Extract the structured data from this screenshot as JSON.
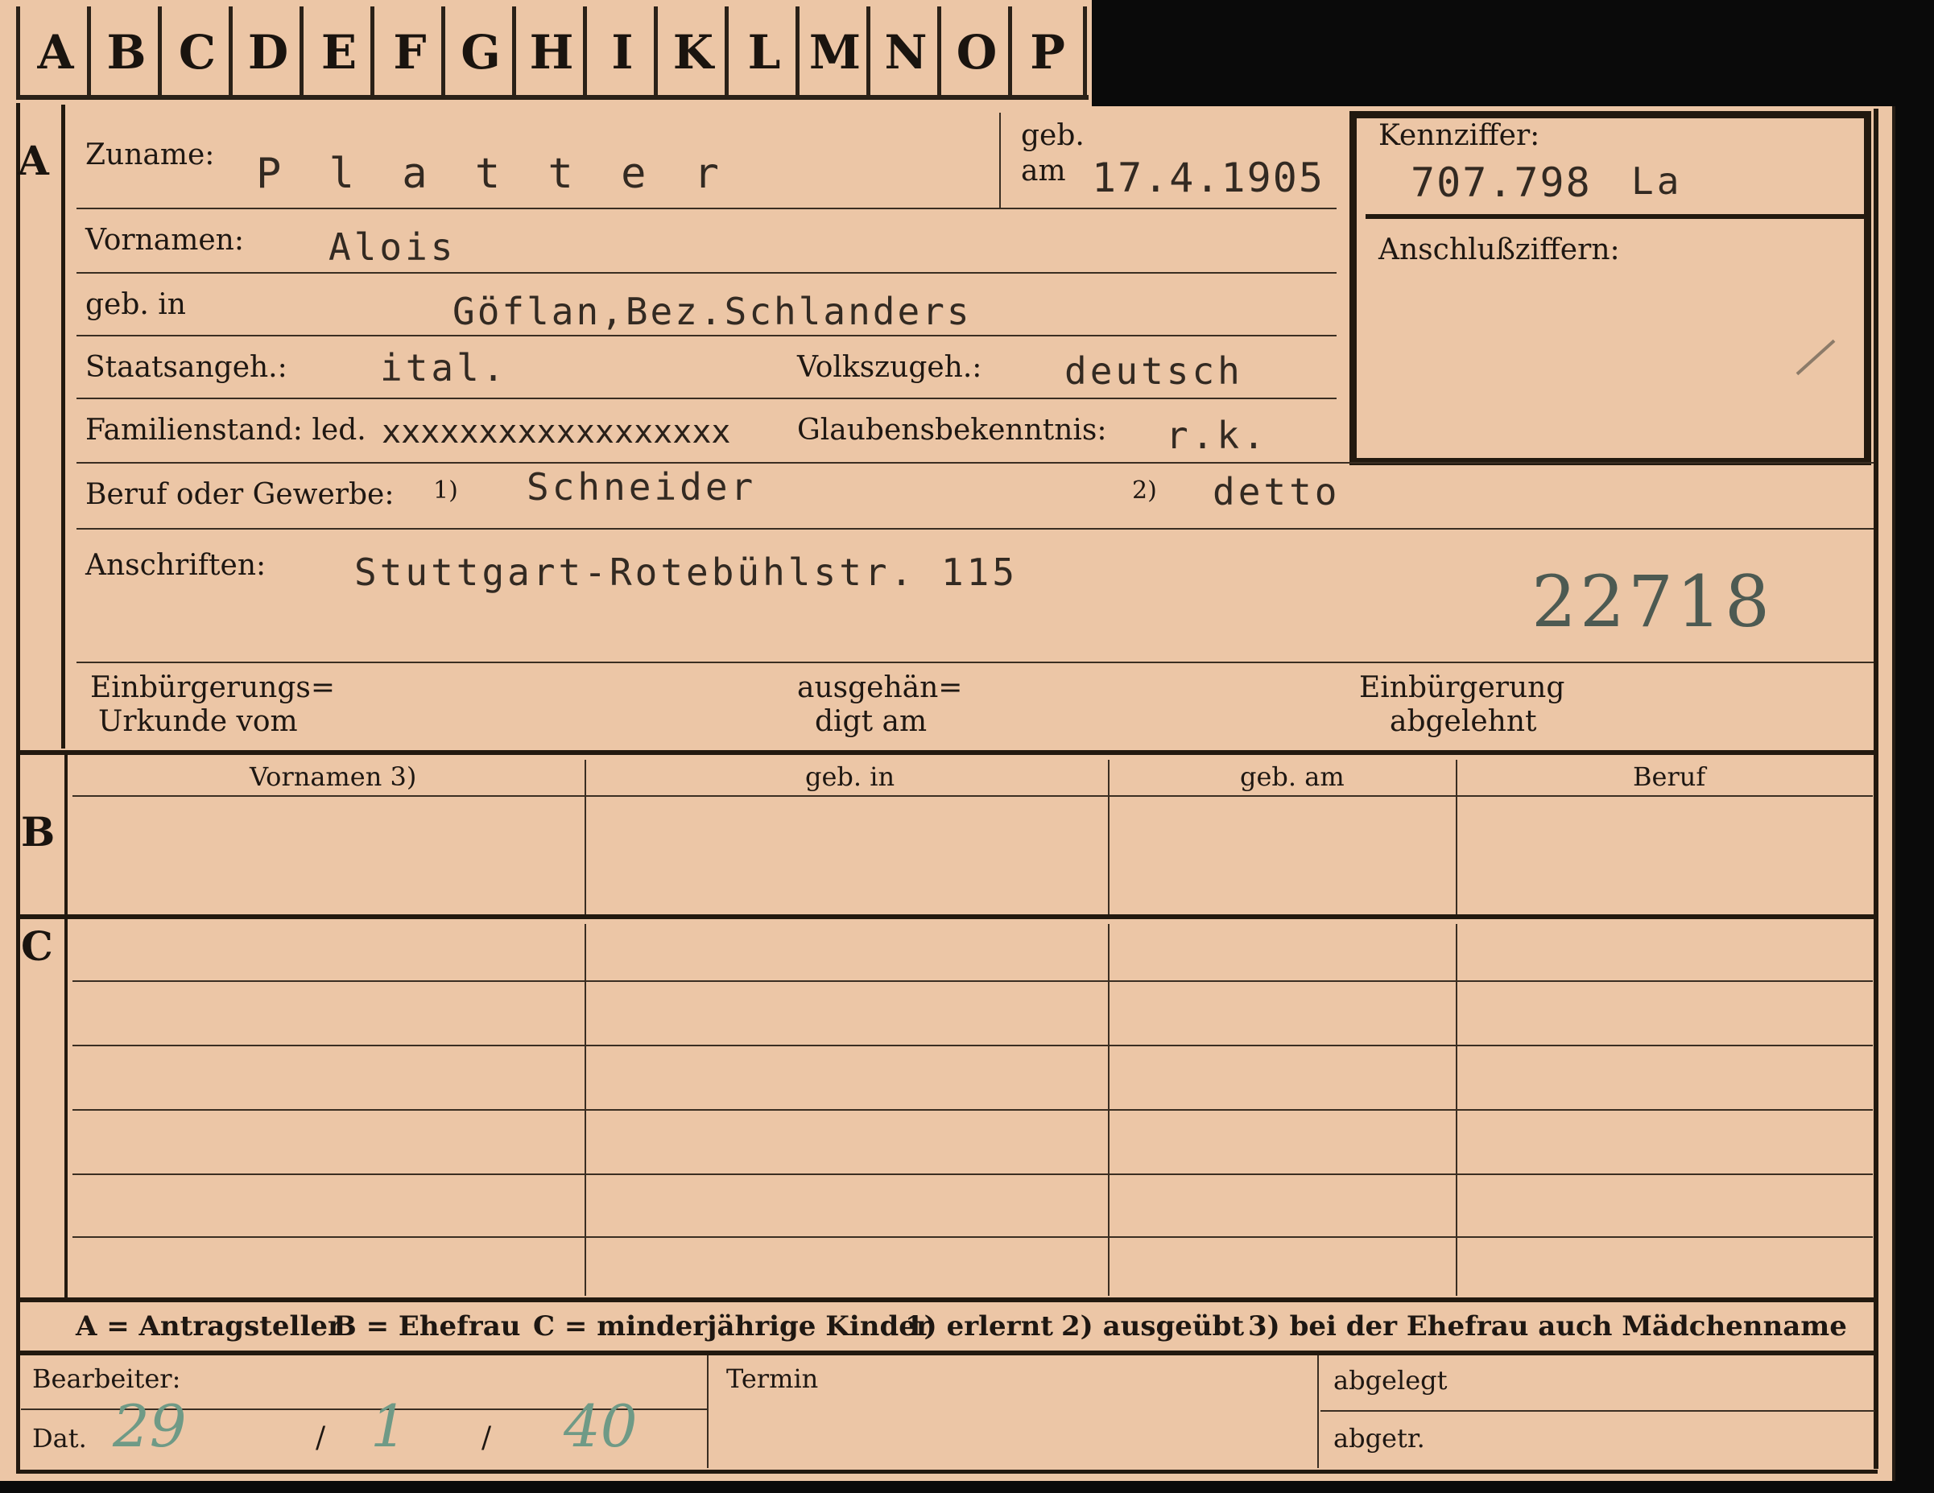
{
  "tabs": [
    "A",
    "B",
    "C",
    "D",
    "E",
    "F",
    "G",
    "H",
    "I",
    "K",
    "L",
    "M",
    "N",
    "O",
    "P"
  ],
  "section_markers": {
    "a": "A",
    "b": "B",
    "c": "C"
  },
  "fields": {
    "zuname_label": "Zuname:",
    "zuname_value": "P l a t t e r",
    "geb_label": "geb.",
    "am_label": "am",
    "geb_am_value": "17.4.1905",
    "kennziffer_label": "Kennziffer:",
    "kennziffer_value": "707.798",
    "kennziffer_suffix": "La",
    "anschluss_label": "Anschlußziffern:",
    "vornamen_label": "Vornamen:",
    "vornamen_value": "Alois",
    "geb_in_label": "geb. in",
    "geb_in_value": "Göflan,Bez.Schlanders",
    "staatsangeh_label": "Staatsangeh.:",
    "staatsangeh_value": "ital.",
    "volkszugeh_label": "Volkszugeh.:",
    "volkszugeh_value": "deutsch",
    "familienstand_label": "Familienstand: led.",
    "familienstand_struck": "xxxxxxxxxxxxxxxxxx",
    "glauben_label": "Glaubensbekenntnis:",
    "glauben_value": "r.k.",
    "beruf_label": "Beruf oder Gewerbe:",
    "beruf_note1": "1)",
    "beruf_value1": "Schneider",
    "beruf_note2": "2)",
    "beruf_value2": "detto",
    "anschriften_label": "Anschriften:",
    "anschriften_value": "Stuttgart-Rotebühlstr. 115",
    "stamp_number": "22718",
    "einb_urkunde_1": "Einbürgerungs=",
    "einb_urkunde_2": "Urkunde vom",
    "ausgehaen_1": "ausgehän=",
    "ausgehaen_2": "digt am",
    "einb_abgelehnt_1": "Einbürgerung",
    "einb_abgelehnt_2": "abgelehnt"
  },
  "table_b_headers": [
    "Vornamen 3)",
    "geb. in",
    "geb. am",
    "Beruf"
  ],
  "legend": {
    "a": "A = Antragsteller",
    "b": "B = Ehefrau",
    "c": "C = minderjährige Kinder",
    "n1": "1) erlernt",
    "n2": "2) ausgeübt",
    "n3": "3) bei der Ehefrau auch Mädchenname"
  },
  "footer": {
    "bearbeiter_label": "Bearbeiter:",
    "dat_label": "Dat.",
    "dat_day": "29",
    "dat_month": "1",
    "dat_year": "40",
    "slash": "/",
    "termin_label": "Termin",
    "abgelegt_label": "abgelegt",
    "abgetr_label": "abgetr."
  }
}
